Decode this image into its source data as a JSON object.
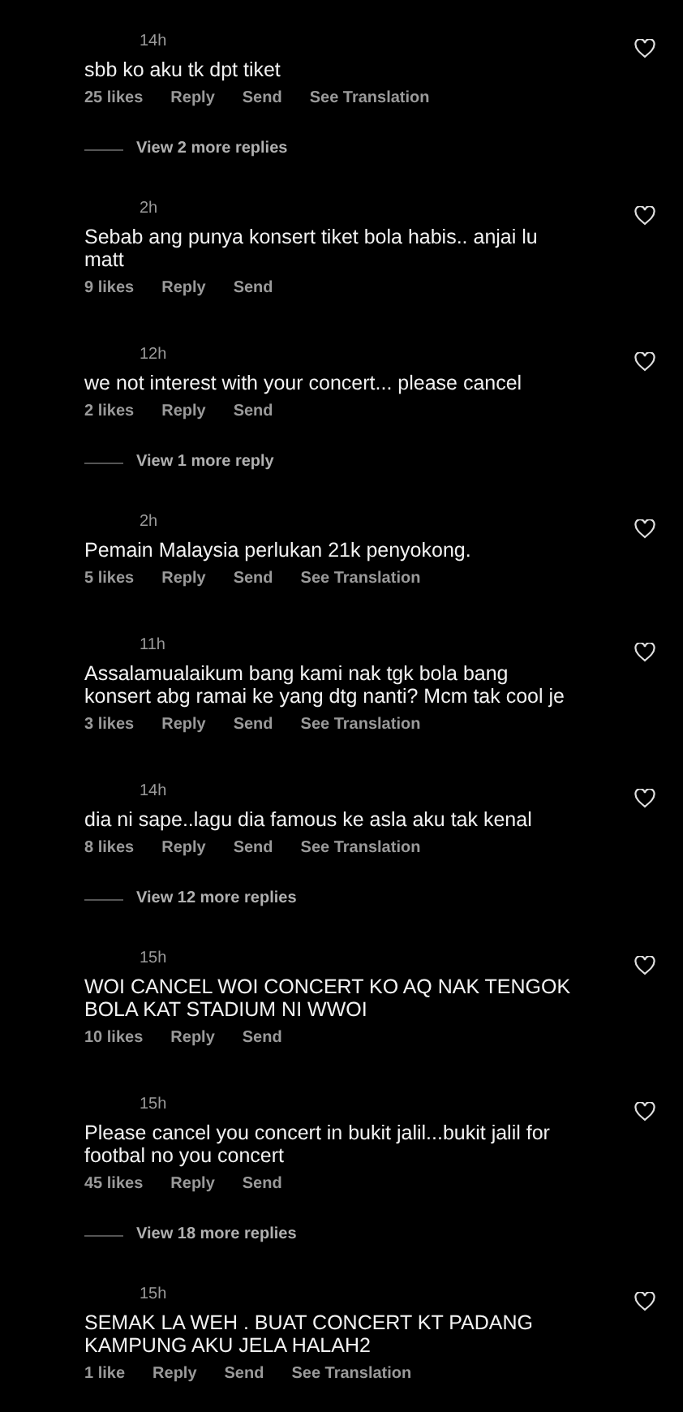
{
  "items": [
    {
      "kind": "comment",
      "time": "14h",
      "text": "sbb ko aku tk dpt tiket",
      "likes": "25 likes",
      "reply": "Reply",
      "send": "Send",
      "translation": "See Translation"
    },
    {
      "kind": "view_replies",
      "label": "View 2 more replies"
    },
    {
      "kind": "comment",
      "time": "2h",
      "text": "Sebab ang punya konsert tiket bola habis.. anjai lu matt",
      "likes": "9 likes",
      "reply": "Reply",
      "send": "Send"
    },
    {
      "kind": "comment",
      "time": "12h",
      "text": "we not interest with your concert... please cancel",
      "likes": "2 likes",
      "reply": "Reply",
      "send": "Send"
    },
    {
      "kind": "view_replies",
      "label": "View 1 more reply"
    },
    {
      "kind": "comment",
      "time": "2h",
      "text": "Pemain Malaysia perlukan 21k penyokong.",
      "likes": "5 likes",
      "reply": "Reply",
      "send": "Send",
      "translation": "See Translation"
    },
    {
      "kind": "comment",
      "time": "11h",
      "text": "Assalamualaikum bang kami nak tgk bola bang konsert abg ramai ke yang dtg nanti? Mcm tak cool je",
      "likes": "3 likes",
      "reply": "Reply",
      "send": "Send",
      "translation": "See Translation"
    },
    {
      "kind": "comment",
      "time": "14h",
      "text": "dia ni sape..lagu dia famous ke asla aku tak kenal",
      "likes": "8 likes",
      "reply": "Reply",
      "send": "Send",
      "translation": "See Translation"
    },
    {
      "kind": "view_replies",
      "label": "View 12 more replies"
    },
    {
      "kind": "comment",
      "time": "15h",
      "text": "WOI CANCEL WOI CONCERT KO AQ NAK TENGOK BOLA KAT STADIUM NI WWOI",
      "likes": "10 likes",
      "reply": "Reply",
      "send": "Send"
    },
    {
      "kind": "comment",
      "time": "15h",
      "text": "Please cancel you concert in bukit jalil...bukit jalil for footbal no you concert",
      "likes": "45 likes",
      "reply": "Reply",
      "send": "Send"
    },
    {
      "kind": "view_replies",
      "label": "View 18 more replies"
    },
    {
      "kind": "comment",
      "time": "15h",
      "text": "SEMAK LA WEH . BUAT CONCERT KT PADANG KAMPUNG AKU JELA HALAH2",
      "likes": "1 like",
      "reply": "Reply",
      "send": "Send",
      "translation": "See Translation"
    }
  ]
}
